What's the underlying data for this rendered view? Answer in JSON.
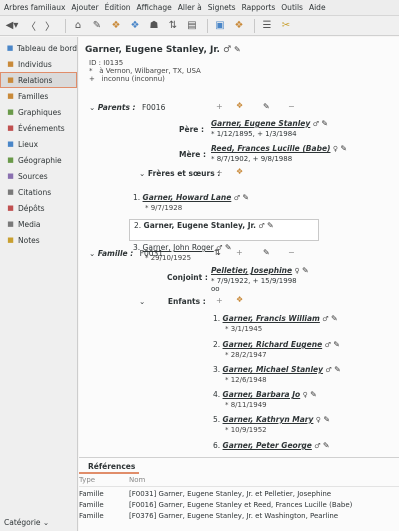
{
  "menu": [
    "Arbres familiaux",
    "Ajouter",
    "Édition",
    "Affichage",
    "Aller à",
    "Signets",
    "Rapports",
    "Outils",
    "Aide"
  ],
  "sidebar": {
    "items": [
      {
        "label": "Tableau de bord",
        "icon": "dashboard-icon",
        "color": "#4a86c8"
      },
      {
        "label": "Individus",
        "icon": "person-icon",
        "color": "#c98a3a"
      },
      {
        "label": "Relations",
        "icon": "relations-icon",
        "color": "#c98a3a",
        "active": true
      },
      {
        "label": "Familles",
        "icon": "family-icon",
        "color": "#c98a3a"
      },
      {
        "label": "Graphiques",
        "icon": "chart-icon",
        "color": "#6a9a4a"
      },
      {
        "label": "Événements",
        "icon": "event-icon",
        "color": "#c05050"
      },
      {
        "label": "Lieux",
        "icon": "globe-icon",
        "color": "#4a86c8"
      },
      {
        "label": "Géographie",
        "icon": "map-icon",
        "color": "#6a9a4a"
      },
      {
        "label": "Sources",
        "icon": "source-icon",
        "color": "#8a70b0"
      },
      {
        "label": "Citations",
        "icon": "citation-icon",
        "color": "#7a7a7a"
      },
      {
        "label": "Dépôts",
        "icon": "repository-icon",
        "color": "#c05050"
      },
      {
        "label": "Media",
        "icon": "media-icon",
        "color": "#7a7a7a"
      },
      {
        "label": "Notes",
        "icon": "note-icon",
        "color": "#c9a030"
      }
    ],
    "category": "Catégorie"
  },
  "person": {
    "name": "Garner, Eugene Stanley, Jr.",
    "id_label": "ID :",
    "id": "I0135",
    "birth": "à Vernon, Wilbarger, TX, USA",
    "death": "inconnu (inconnu)"
  },
  "parents": {
    "label": "Parents :",
    "family_id": "F0016",
    "father_label": "Père :",
    "father": "Garner, Eugene Stanley",
    "father_dates": "* 1/12/1895, + 1/3/1984",
    "mother_label": "Mère :",
    "mother": "Reed, Frances Lucille (Babe)",
    "mother_dates": "* 8/7/1902, + 9/8/1988",
    "siblings_label": "Frères et sœurs :",
    "siblings": [
      {
        "num": "1.",
        "name": "Garner, Howard Lane",
        "date": "* 9/7/1928"
      },
      {
        "num": "2.",
        "name": "Garner, Eugene Stanley, Jr.",
        "date": ""
      },
      {
        "num": "3.",
        "name": "Garner, John Roger",
        "date": "* 29/10/1925"
      }
    ]
  },
  "family": {
    "label": "Famille :",
    "family_id": "F0031",
    "spouse_label": "Conjoint :",
    "spouse": "Pelletier, Josephine",
    "spouse_dates": "* 7/9/1922, + 15/9/1998",
    "marriage": "oo",
    "children_label": "Enfants :",
    "children": [
      {
        "num": "1.",
        "name": "Garner, Francis William",
        "sex": "♂",
        "date": "* 3/1/1945"
      },
      {
        "num": "2.",
        "name": "Garner, Richard Eugene",
        "sex": "♂",
        "date": "* 28/2/1947"
      },
      {
        "num": "3.",
        "name": "Garner, Michael Stanley",
        "sex": "♂",
        "date": "* 12/6/1948"
      },
      {
        "num": "4.",
        "name": "Garner, Barbara Jo",
        "sex": "♀",
        "date": "* 8/11/1949"
      },
      {
        "num": "5.",
        "name": "Garner, Kathryn Mary",
        "sex": "♀",
        "date": "* 10/9/1952"
      },
      {
        "num": "6.",
        "name": "Garner, Peter George",
        "sex": "♂",
        "date": ""
      }
    ]
  },
  "references": {
    "tab": "Références",
    "col_type": "Type",
    "col_name": "Nom",
    "rows": [
      {
        "type": "Famille",
        "name": "[F0031] Garner, Eugene Stanley, Jr. et Pelletier, Josephine"
      },
      {
        "type": "Famille",
        "name": "[F0016] Garner, Eugene Stanley et Reed, Frances Lucille (Babe)"
      },
      {
        "type": "Famille",
        "name": "[F0376] Garner, Eugene Stanley, Jr. et Washington, Pearline"
      }
    ]
  }
}
